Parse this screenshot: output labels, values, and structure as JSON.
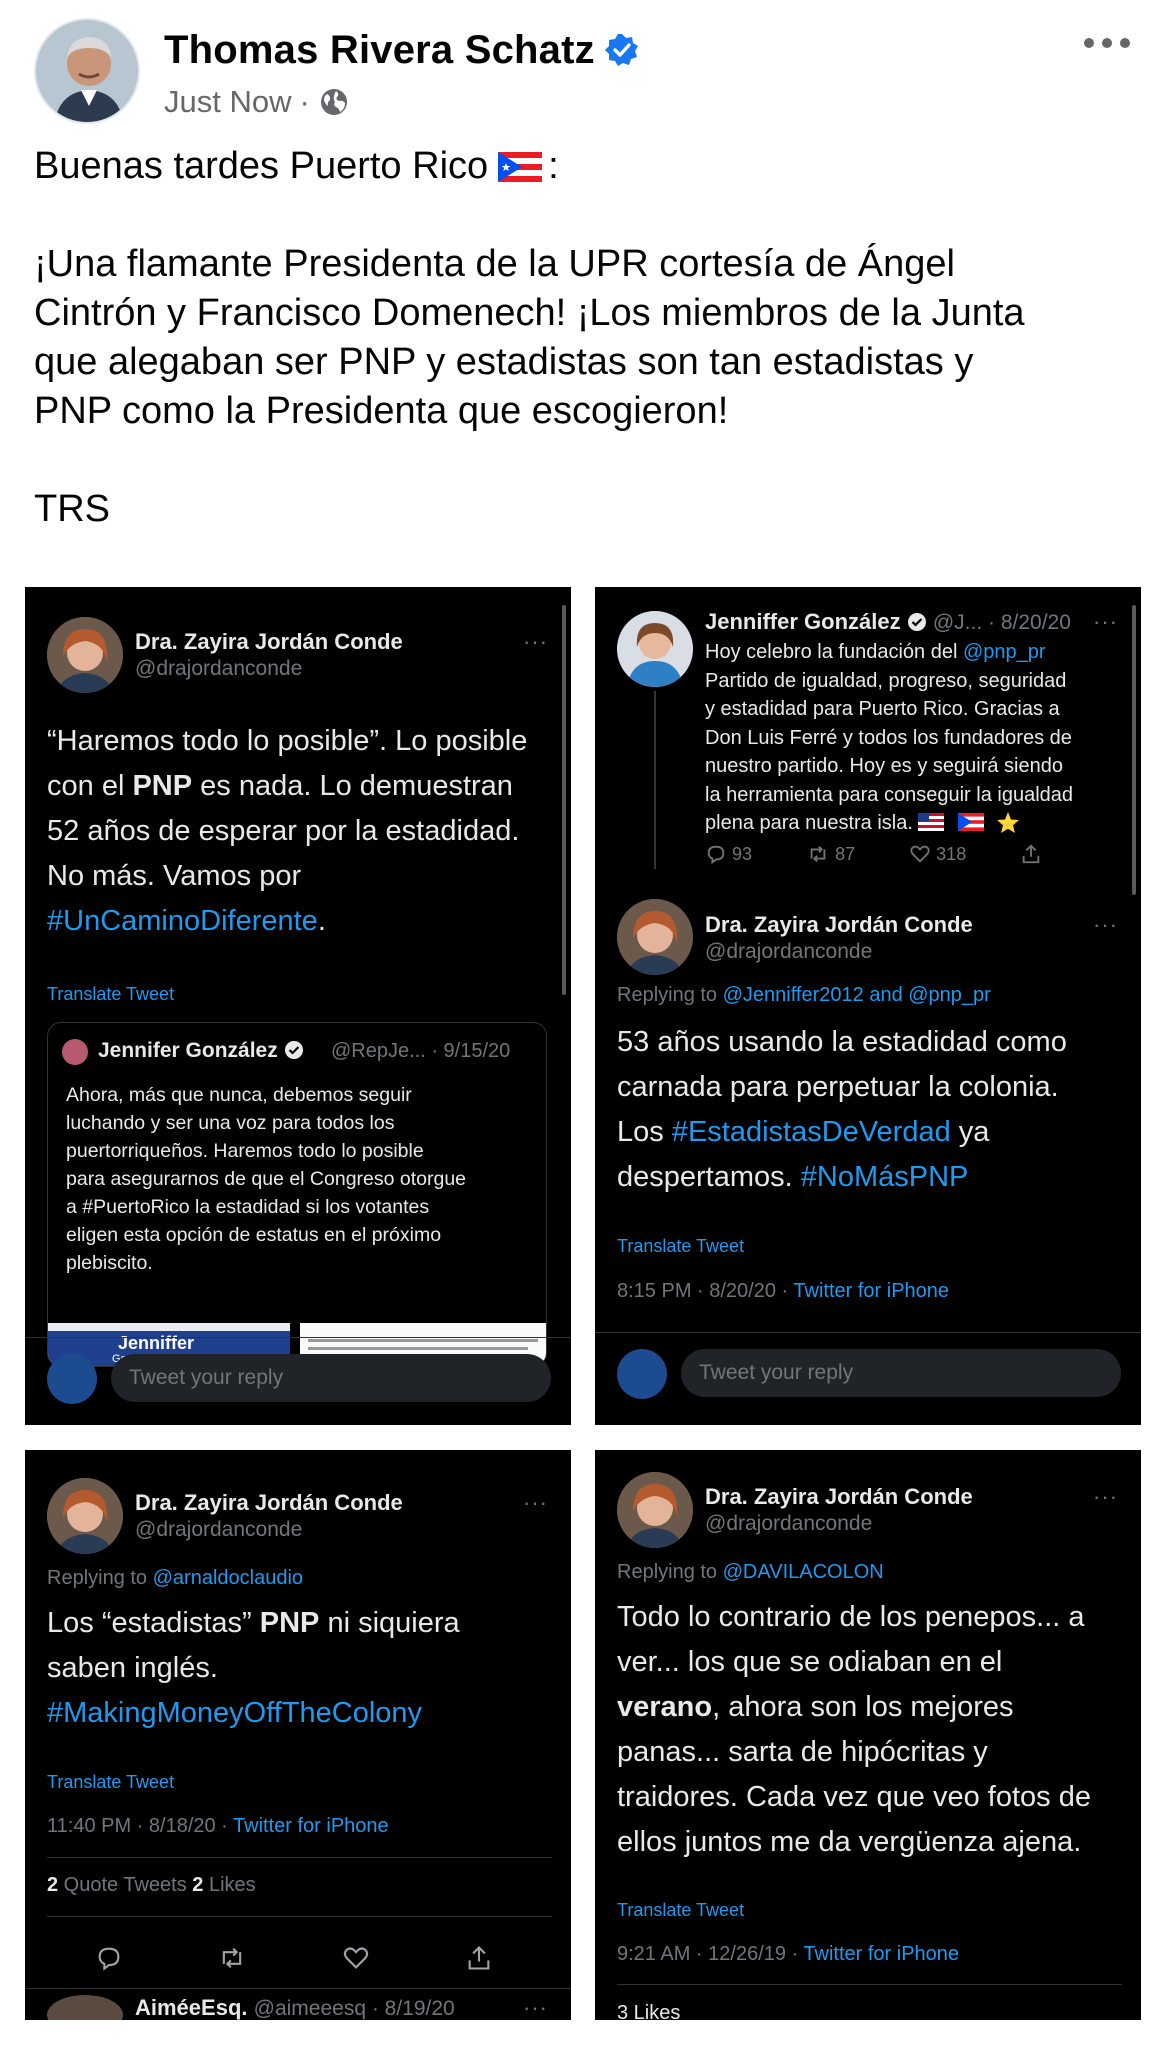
{
  "post": {
    "author": "Thomas Rivera Schatz",
    "time": "Just Now",
    "separator": "·",
    "greeting": "Buenas tardes Puerto Rico",
    "greeting_suffix": ":",
    "body_line1": "¡Una flamante Presidenta de la UPR cortesía de Ángel",
    "body_line2": "Cintrón y Francisco Domenech! ¡Los miembros de la Junta",
    "body_line3": "que alegaban ser PNP y estadistas son tan estadistas y",
    "body_line4": "PNP como la Presidenta que escogieron!",
    "signature": "TRS"
  },
  "tweet1": {
    "name": "Dra. Zayira Jordán Conde",
    "handle": "@drajordanconde",
    "dots": "···",
    "line1": "“Haremos todo lo posible”. Lo posible",
    "line2_a": "con el ",
    "line2_b": "PNP",
    "line2_c": " es nada. Lo demuestran",
    "line3": "52 años de esperar por la estadidad.",
    "line4": "No más. Vamos por",
    "hashtag": "#UnCaminoDiferente",
    "hashtag_end": ".",
    "translate": "Translate Tweet",
    "quote_name": "Jennifer González",
    "quote_handle": "@RepJe... · 9/15/20",
    "quote_text1": "Ahora, más que nunca, debemos seguir",
    "quote_text2": "luchando y ser una voz para todos los",
    "quote_text3": "puertorriqueños. Haremos todo lo posible",
    "quote_text4": "para asegurarnos de que el Congreso otorgue",
    "quote_text5": "a #PuertoRico la estadidad si los votantes",
    "quote_text6": "eligen esta opción de estatus en el próximo",
    "quote_text7": "plebiscito.",
    "quote_img_title": "Jenniffer",
    "quote_img_sub": "González-Colón",
    "reply_placeholder": "Tweet your reply"
  },
  "tweet2": {
    "parent_name": "Jenniffer González",
    "parent_handle": "@J... · 8/20/20",
    "parent_dots": "···",
    "parent_l1_a": "Hoy celebro la fundación del ",
    "parent_l1_link": "@pnp_pr",
    "parent_l2": "Partido de igualdad, progreso, seguridad",
    "parent_l3": "y estadidad para Puerto Rico.  Gracias a",
    "parent_l4": "Don Luis Ferré y todos los fundadores de",
    "parent_l5": "nuestro partido. Hoy es y seguirá siendo",
    "parent_l6": "la herramienta para conseguir la igualdad",
    "parent_l7": "plena para nuestra isla.",
    "replies": "93",
    "retweets": "87",
    "likes": "318",
    "name": "Dra. Zayira Jordán Conde",
    "handle": "@drajordanconde",
    "dots": "···",
    "replying_to": "Replying to ",
    "replying_users": "@Jenniffer2012 and @pnp_pr",
    "line1": "53 años usando la estadidad como",
    "line2": "carnada para perpetuar la colonia.",
    "line3_a": "Los ",
    "line3_tag": "#EstadistasDeVerdad",
    "line3_b": " ya",
    "line4_a": "despertamos. ",
    "line4_tag": "#NoMásPNP",
    "translate": "Translate Tweet",
    "timestamp": "8:15 PM · 8/20/20 · ",
    "client": "Twitter for iPhone",
    "reply_placeholder": "Tweet your reply"
  },
  "tweet3": {
    "name": "Dra. Zayira Jordán Conde",
    "handle": "@drajordanconde",
    "dots": "···",
    "replying_to": "Replying to ",
    "replying_user": "@arnaldoclaudio",
    "line1_a": "Los “estadistas” ",
    "line1_b": "PNP",
    "line1_c": " ni siquiera",
    "line2": "saben inglés.",
    "hashtag": "#MakingMoneyOffTheColony",
    "translate": "Translate Tweet",
    "timestamp": "11:40 PM · 8/18/20 · ",
    "client": "Twitter for iPhone",
    "quote_count": "2",
    "quote_label": " Quote Tweets  ",
    "like_count": "2",
    "like_label": " Likes",
    "next_name": "AiméeEsq.",
    "next_handle": "@aimeeesq · 8/19/20",
    "next_dots": "···"
  },
  "tweet4": {
    "name": "Dra. Zayira Jordán Conde",
    "handle": "@drajordanconde",
    "dots": "···",
    "replying_to": "Replying to ",
    "replying_user": "@DAVILACOLON",
    "line1": "Todo lo contrario de los penepos... a",
    "line2": "ver... los que se odiaban en el",
    "line3": "verano",
    "line3_b": ", ahora son los mejores",
    "line4": "panas... sarta de hipócritas y",
    "line5": "traidores. Cada vez que veo fotos de",
    "line6": "ellos juntos me da vergüenza ajena.",
    "translate": "Translate Tweet",
    "timestamp": "9:21 AM · 12/26/19 · ",
    "client": "Twitter for iPhone",
    "likes_partial": "3 Likes"
  },
  "colors": {
    "link_blue": "#1d9bf0",
    "verified_blue": "#1877f2",
    "tweet_bg": "#000000",
    "muted": "#71767b"
  },
  "icons": [
    "verified-badge-icon",
    "globe-icon",
    "more-options-icon",
    "puerto-rico-flag-icon",
    "reply-icon",
    "retweet-icon",
    "like-icon",
    "share-icon"
  ]
}
